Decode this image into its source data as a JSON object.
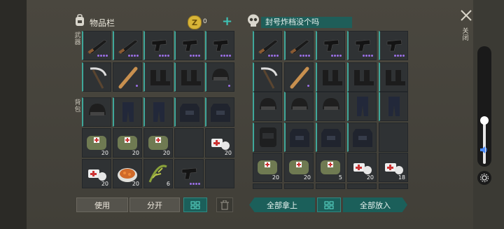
{
  "inventory": {
    "title": "物品栏",
    "coins": "0",
    "weapon_label": "武器",
    "backpack_label": "背包"
  },
  "loot": {
    "title": "封号炸档没个吗"
  },
  "buttons": {
    "use": "使用",
    "split": "分开",
    "take_all": "全部拿上",
    "put_all": "全部放入"
  },
  "side": {
    "close_label": "关闭"
  },
  "left_counts": {
    "r3c1": "20",
    "r3c2": "20",
    "r3c3": "20",
    "r3c5": "20",
    "r4c1": "20",
    "r4c2": "20",
    "r4c3": "6"
  },
  "right_counts": {
    "r4c1": "20",
    "r4c2": "20",
    "r4c3": "5",
    "r4c4": "20",
    "r4c5": "18"
  },
  "colors": {
    "accent": "#1b5f5a",
    "highlight": "#3fa79a",
    "rarity": "#9b6fe6"
  }
}
